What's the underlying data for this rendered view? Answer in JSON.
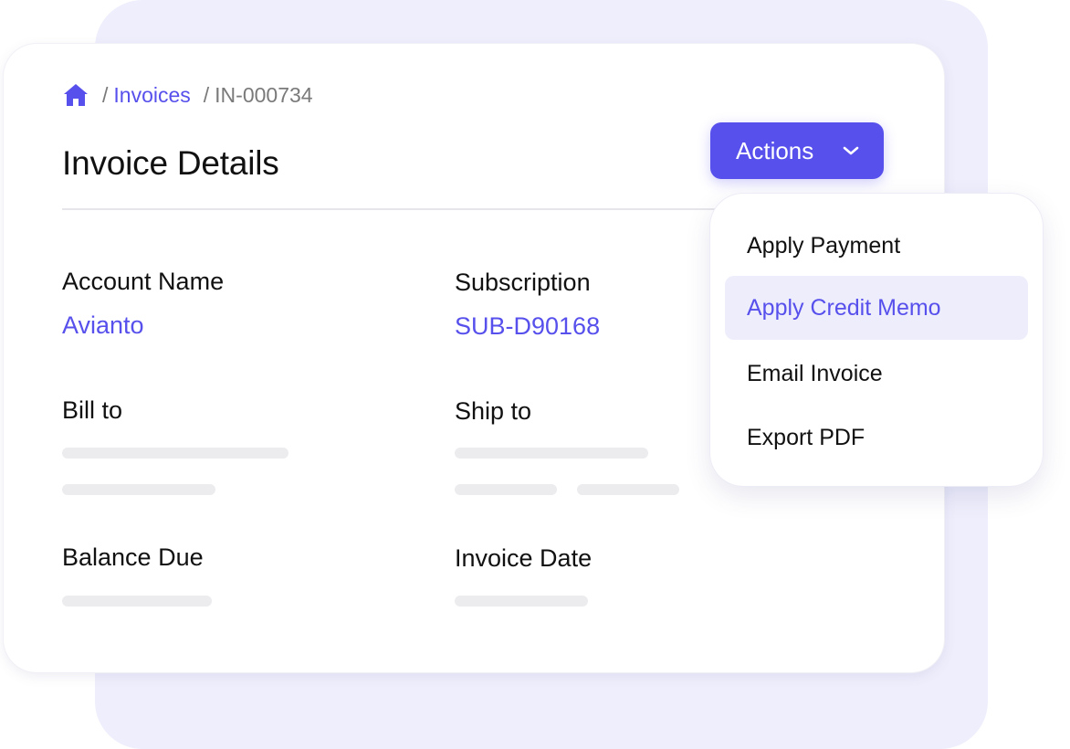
{
  "breadcrumb": {
    "home_icon": "home-icon",
    "separator": "/",
    "invoices": "Invoices",
    "current": "IN-000734"
  },
  "page_title": "Invoice Details",
  "actions": {
    "label": "Actions",
    "icon": "chevron-down-icon",
    "menu": [
      {
        "label": "Apply Payment",
        "active": false
      },
      {
        "label": "Apply Credit Memo",
        "active": true
      },
      {
        "label": "Email Invoice",
        "active": false
      },
      {
        "label": "Export PDF",
        "active": false
      }
    ]
  },
  "fields": {
    "account_name": {
      "label": "Account Name",
      "value": "Avianto"
    },
    "subscription": {
      "label": "Subscription",
      "value": "SUB-D90168"
    },
    "bill_to": {
      "label": "Bill to"
    },
    "ship_to": {
      "label": "Ship to"
    },
    "balance_due": {
      "label": "Balance Due"
    },
    "invoice_date": {
      "label": "Invoice Date"
    }
  },
  "colors": {
    "accent": "#5750ec",
    "accent_light": "#ededfc",
    "background_panel": "#eeeefc",
    "skeleton": "#ececef",
    "text": "#111111",
    "muted_text": "#7a7a7a"
  }
}
